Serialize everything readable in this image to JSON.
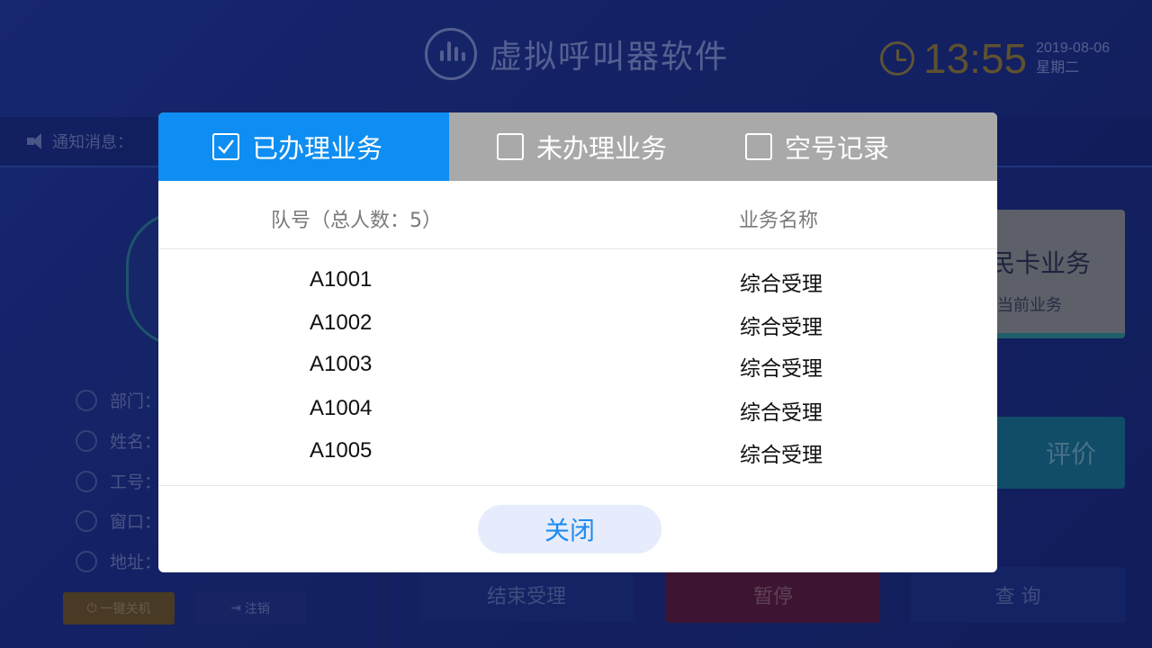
{
  "app": {
    "title": "虚拟呼叫器软件",
    "time": "13:55",
    "date": "2019-08-06",
    "weekday": "星期二",
    "notice_label": "通知消息："
  },
  "left_panel": {
    "fields": [
      {
        "label": "部门：",
        "icon": "department-icon"
      },
      {
        "label": "姓名：",
        "icon": "person-icon"
      },
      {
        "label": "工号：",
        "icon": "id-icon"
      },
      {
        "label": "窗口：",
        "icon": "window-icon"
      },
      {
        "label": "地址：",
        "icon": "ip-icon"
      }
    ],
    "power_label": "一键关机",
    "logout_label": "注销"
  },
  "right_panel": {
    "card_title": "民卡业务",
    "card_sub": "当前业务",
    "evaluate_label": "评价"
  },
  "bottom_buttons": {
    "finish": "结束受理",
    "pause": "暂停",
    "query": "查 询"
  },
  "modal": {
    "tabs": [
      {
        "label": "已办理业务",
        "checked": true
      },
      {
        "label": "未办理业务",
        "checked": false
      },
      {
        "label": "空号记录",
        "checked": false
      }
    ],
    "columns": {
      "queue": "队号（总人数：5）",
      "service": "业务名称"
    },
    "rows": [
      {
        "queue": "A1001",
        "service": "综合受理"
      },
      {
        "queue": "A1002",
        "service": "综合受理"
      },
      {
        "queue": "A1003",
        "service": "综合受理"
      },
      {
        "queue": "A1004",
        "service": "综合受理"
      },
      {
        "queue": "A1005",
        "service": "综合受理"
      }
    ],
    "close_label": "关闭"
  },
  "colors": {
    "active_tab": "#0e8ef2",
    "inactive_tab": "#a9a9a9",
    "close_text": "#1f8cf0"
  }
}
